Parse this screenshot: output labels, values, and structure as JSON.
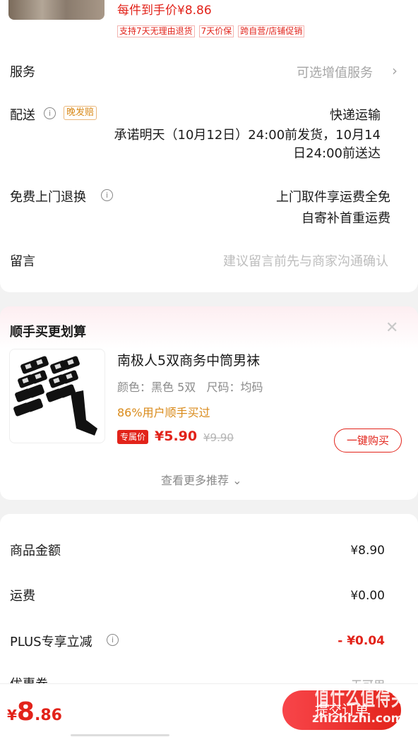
{
  "product_top": {
    "price_line": "每件到手价¥8.86",
    "tags": [
      "支持7天无理由退货",
      "7天价保",
      "跨自营/店铺促销"
    ]
  },
  "service": {
    "label": "服务",
    "value": "可选增值服务",
    "chevron": "›"
  },
  "delivery": {
    "label": "配送",
    "badge": "晚发赔",
    "method": "快递运输",
    "promise_line1": "承诺明天（10月12日）24:00前发货，10月14",
    "promise_line2": "日24:00前送达"
  },
  "return": {
    "label": "免费上门退换",
    "line1": "上门取件享运费全免",
    "line2": "自寄补首重运费"
  },
  "message": {
    "label": "留言",
    "placeholder": "建议留言前先与商家沟通确认"
  },
  "recommend": {
    "title": "顺手买更划算",
    "close": "✕",
    "product_name": "南极人5双商务中筒男袜",
    "spec": "颜色：黑色 5双   尺码：均码",
    "social": "86%用户顺手买过",
    "price_tag": "专属价",
    "price": "¥5.90",
    "orig_price": "¥9.90",
    "buy_button": "一键购买",
    "more": "查看更多推荐",
    "more_icon": "⌄"
  },
  "summary": {
    "rows": [
      {
        "label": "商品金额",
        "value": "¥8.90"
      },
      {
        "label": "运费",
        "value": "¥0.00"
      },
      {
        "label": "PLUS专享立减",
        "value": "- ¥0.04"
      },
      {
        "label": "优惠券",
        "value": "无可用"
      }
    ]
  },
  "bottom": {
    "currency": "¥",
    "price_int": "8",
    "price_dec": ".86",
    "submit": "提交订单"
  },
  "watermark": {
    "top": "值什么值得买",
    "bottom": "zhizhizhi.com"
  },
  "colors": {
    "accent": "#e2231a",
    "orange": "#d98a1a"
  }
}
